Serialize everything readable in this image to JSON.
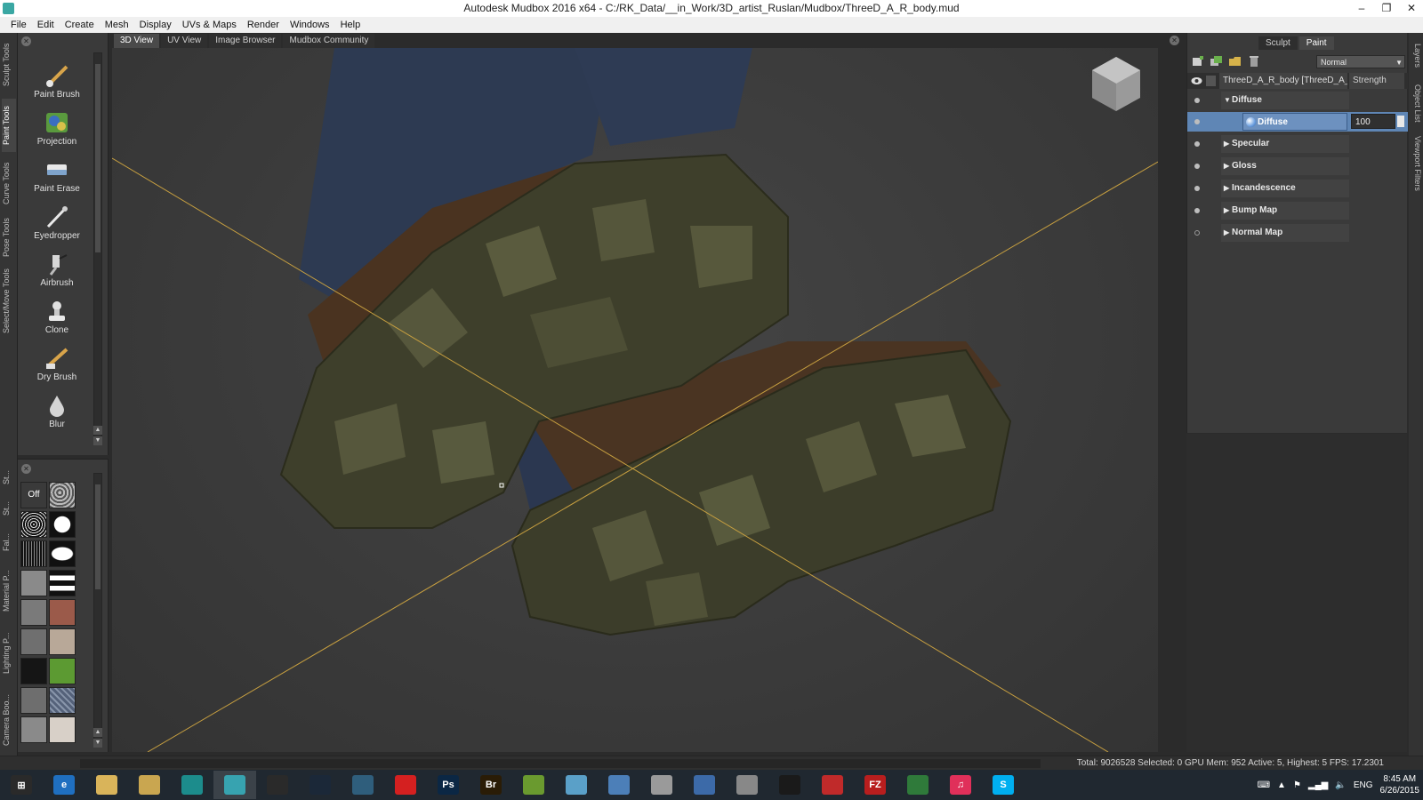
{
  "window": {
    "title": "Autodesk Mudbox 2016 x64 - C:/RK_Data/__in_Work/3D_artist_Ruslan/Mudbox/ThreeD_A_R_body.mud",
    "min": "–",
    "max": "❐",
    "close": "✕"
  },
  "menu": [
    "File",
    "Edit",
    "Create",
    "Mesh",
    "Display",
    "UVs & Maps",
    "Render",
    "Windows",
    "Help"
  ],
  "left_tabs": [
    "Sculpt Tools",
    "Paint Tools",
    "Curve Tools",
    "Pose Tools",
    "Select/Move Tools"
  ],
  "stamp_tabs": [
    "St...",
    "St...",
    "Fal...",
    "Material P...",
    "Lighting P...",
    "Camera Boo..."
  ],
  "tools": [
    "Paint Brush",
    "Projection",
    "Paint Erase",
    "Eyedropper",
    "Airbrush",
    "Clone",
    "Dry Brush",
    "Blur"
  ],
  "stamp_off_label": "Off",
  "viewport_tabs": [
    "3D View",
    "UV View",
    "Image Browser",
    "Mudbox Community"
  ],
  "right_panel": {
    "tabs": [
      "Sculpt",
      "Paint"
    ],
    "blend_mode": "Normal",
    "layer_name": "ThreeD_A_R_body [ThreeD_A_R...",
    "strength_label": "Strength",
    "channels": [
      {
        "name": "Diffuse",
        "expanded": true,
        "visible": true
      },
      {
        "name": "Specular",
        "visible": true
      },
      {
        "name": "Gloss",
        "visible": true
      },
      {
        "name": "Incandescence",
        "visible": true
      },
      {
        "name": "Bump Map",
        "visible": true
      },
      {
        "name": "Normal Map",
        "visible": false
      }
    ],
    "selected_layer": {
      "name": "Diffuse",
      "value": "100"
    }
  },
  "right_tabs": [
    "Layers",
    "Object List",
    "Viewport Filters"
  ],
  "status": "Total: 9026528  Selected: 0 GPU Mem: 952  Active: 5, Highest: 5  FPS: 17.2301",
  "taskbar": {
    "apps": [
      {
        "icon": "start-icon",
        "color": "#2a2a2a",
        "label": "⊞"
      },
      {
        "icon": "ie-icon",
        "color": "#1f6fc0",
        "label": "e"
      },
      {
        "icon": "folder-icon",
        "color": "#d9b45a",
        "label": ""
      },
      {
        "icon": "explorer-icon",
        "color": "#c9a650",
        "label": ""
      },
      {
        "icon": "maya-icon",
        "color": "#1c8c8c",
        "label": ""
      },
      {
        "icon": "mudbox-icon",
        "color": "#37a3b0",
        "label": ""
      },
      {
        "icon": "obs-icon",
        "color": "#2a2a2a",
        "label": ""
      },
      {
        "icon": "steam-icon",
        "color": "#1b2838",
        "label": ""
      },
      {
        "icon": "app-icon",
        "color": "#2f5e7c",
        "label": ""
      },
      {
        "icon": "creative-cloud-icon",
        "color": "#d42020",
        "label": ""
      },
      {
        "icon": "photoshop-icon",
        "color": "#0b2744",
        "label": "Ps"
      },
      {
        "icon": "bridge-icon",
        "color": "#2a1c06",
        "label": "Br"
      },
      {
        "icon": "sheet-icon",
        "color": "#6a9a2f",
        "label": ""
      },
      {
        "icon": "notes-icon",
        "color": "#5aa0c8",
        "label": ""
      },
      {
        "icon": "calculator-icon",
        "color": "#4c7fb8",
        "label": ""
      },
      {
        "icon": "paint-icon",
        "color": "#9a9a9a",
        "label": ""
      },
      {
        "icon": "window-icon",
        "color": "#3c6aa8",
        "label": ""
      },
      {
        "icon": "image-viewer-icon",
        "color": "#888888",
        "label": ""
      },
      {
        "icon": "nvidia-icon",
        "color": "#1a1a1a",
        "label": ""
      },
      {
        "icon": "flash-icon",
        "color": "#c02a2a",
        "label": ""
      },
      {
        "icon": "filezilla-icon",
        "color": "#b81e1e",
        "label": "FZ"
      },
      {
        "icon": "globe-icon",
        "color": "#2f7a3a",
        "label": ""
      },
      {
        "icon": "itunes-icon",
        "color": "#e0305a",
        "label": "♫"
      },
      {
        "icon": "skype-icon",
        "color": "#00aff0",
        "label": "S"
      }
    ],
    "lang": "ENG",
    "time": "8:45 AM",
    "date": "6/26/2015"
  }
}
